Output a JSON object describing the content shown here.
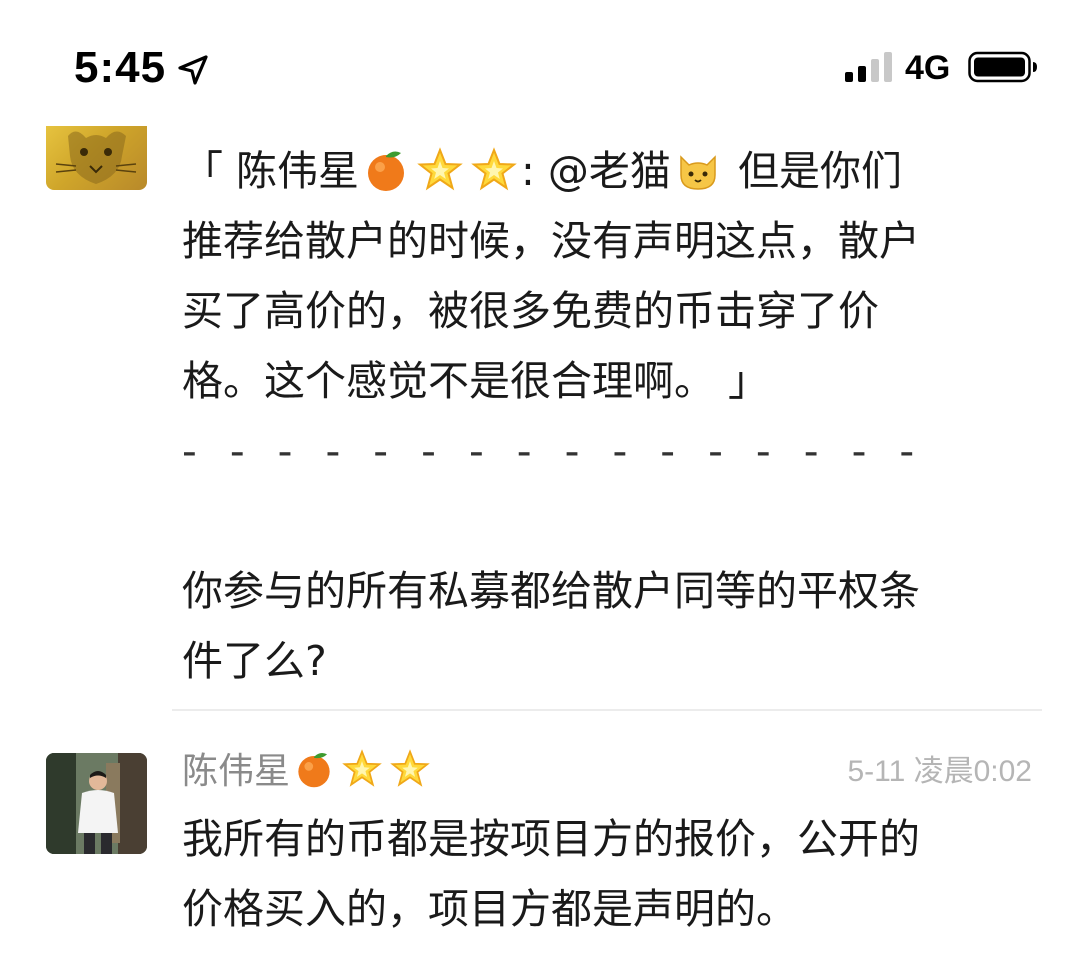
{
  "status_bar": {
    "time": "5:45",
    "network": "4G",
    "icons": [
      "location-arrow-icon",
      "signal-icon",
      "battery-icon"
    ]
  },
  "comment_1": {
    "quote_open": "「 陈伟星",
    "quote_after_emojis": ": @老猫",
    "quote_line1_tail": " 但是你们",
    "line2": "推荐给散户的时候，没有声明这点，散户",
    "line3": "买了高价的，被很多免费的币击穿了价",
    "line4": "格。这个感觉不是很合理啊。 」",
    "separator": "- - - - - - - - - - - - - - - -",
    "reply_line1": "你参与的所有私募都给散户同等的平权条",
    "reply_line2": "件了么?"
  },
  "comment_2": {
    "author": "陈伟星",
    "timestamp": "5-11 凌晨0:02",
    "line1": "我所有的币都是按项目方的报价，公开的",
    "line2": "价格买入的，项目方都是声明的。"
  },
  "colors": {
    "text": "#1a1a1a",
    "author": "#8a8a8a",
    "timestamp": "#b5b5b5",
    "divider": "#ececec"
  }
}
